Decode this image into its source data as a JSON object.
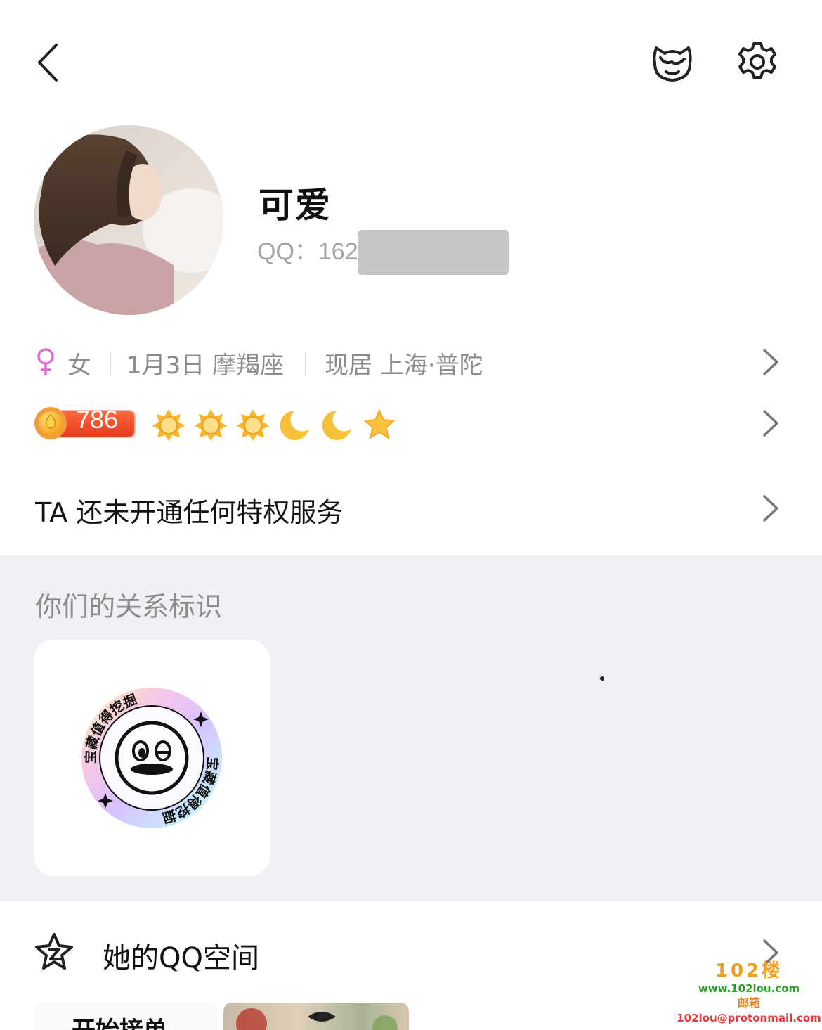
{
  "header": {
    "back_icon": "chevron-left-icon",
    "pet_icon": "cat-face-icon",
    "settings_icon": "gear-icon"
  },
  "profile": {
    "nickname": "可爱",
    "qq_label": "QQ：162"
  },
  "info": {
    "gender": "女",
    "gender_color": "#e36ad8",
    "birthday": "1月3日 摩羯座",
    "location": "现居 上海·普陀"
  },
  "level": {
    "value": "786",
    "icons": [
      "sun",
      "sun",
      "sun",
      "moon",
      "moon",
      "star"
    ],
    "badge_color": "#e8422a"
  },
  "privilege": {
    "text": "TA 还未开通任何特权服务"
  },
  "relationship": {
    "title": "你们的关系标识",
    "badge_text": "宝藏值得挖掘"
  },
  "qzone": {
    "label": "她的QQ空间"
  },
  "thumbnails": {
    "first_text": "开始接单"
  },
  "watermark": {
    "logo": "102楼",
    "url": "www.102lou.com",
    "label": "邮箱",
    "email": "102lou@protonmail.com"
  }
}
